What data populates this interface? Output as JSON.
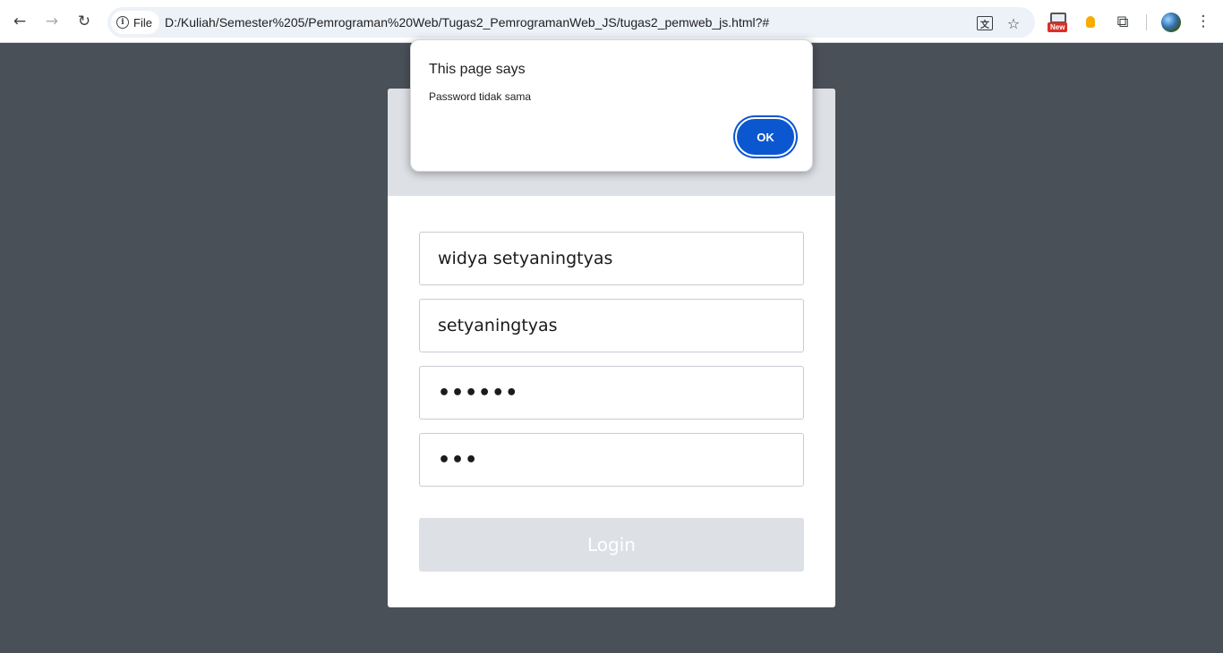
{
  "browser": {
    "back_glyph": "←",
    "forward_glyph": "→",
    "reload_glyph": "↻",
    "site_chip_label": "File",
    "url": "D:/Kuliah/Semester%205/Pemrograman%20Web/Tugas2_PemrogramanWeb_JS/tugas2_pemweb_js.html?#",
    "translate_glyph": "文",
    "star_glyph": "☆",
    "extension_badge": "New",
    "puzzle_glyph": "⧉",
    "menu_glyph": "⋮",
    "icons": [
      "back-icon",
      "forward-icon",
      "reload-icon",
      "info-icon",
      "translate-icon",
      "bookmark-star-icon",
      "new-extension-icon",
      "bulb-extension-icon",
      "extensions-puzzle-icon",
      "profile-avatar",
      "more-menu-icon"
    ]
  },
  "dialog": {
    "title": "This page says",
    "message": "Password tidak sama",
    "ok_label": "OK"
  },
  "form": {
    "fields": [
      {
        "value": "widya setyaningtyas",
        "type": "text"
      },
      {
        "value": "setyaningtyas",
        "type": "text"
      },
      {
        "value": "••••••",
        "type": "password"
      },
      {
        "value": "•••",
        "type": "password"
      }
    ],
    "login_label": "Login"
  },
  "colors": {
    "page_background": "#4a5058",
    "card_header": "#dde0e5",
    "login_button": "#dde0e5",
    "ok_button": "#0b57d0",
    "extension_badge": "#d93025"
  }
}
